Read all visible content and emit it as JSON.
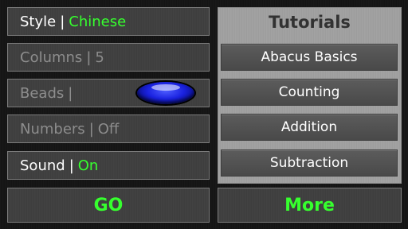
{
  "settings": {
    "style": {
      "label": "Style",
      "sep": "|",
      "value": "Chinese"
    },
    "columns": {
      "label": "Columns",
      "sep": "|",
      "value": "5"
    },
    "beads": {
      "label": "Beads",
      "sep": "|",
      "bead_color": "#1a22e0"
    },
    "numbers": {
      "label": "Numbers",
      "sep": "|",
      "value": "Off"
    },
    "sound": {
      "label": "Sound",
      "sep": "|",
      "value": "On"
    }
  },
  "tutorials": {
    "title": "Tutorials",
    "items": [
      "Abacus Basics",
      "Counting",
      "Addition",
      "Subtraction"
    ]
  },
  "buttons": {
    "go": "GO",
    "more": "More"
  },
  "colors": {
    "accent_green": "#36ff2e",
    "dim_text": "#8d8d8d"
  }
}
